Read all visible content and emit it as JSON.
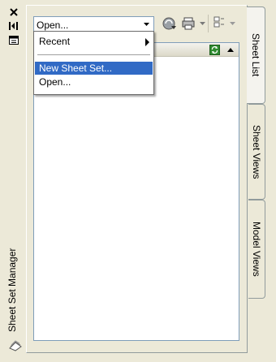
{
  "window": {
    "title": "Sheet Set Manager"
  },
  "combo": {
    "value": "Open..."
  },
  "dropdown": {
    "items": [
      {
        "label": "Recent",
        "submenu": true
      },
      {
        "label": "New Sheet Set...",
        "highlighted": true
      },
      {
        "label": "Open..."
      }
    ]
  },
  "tabs": [
    {
      "label": "Sheet List",
      "active": true
    },
    {
      "label": "Sheet Views"
    },
    {
      "label": "Model Views"
    }
  ],
  "icons": {
    "close": "close-icon",
    "autohide": "autohide-icon",
    "properties": "properties-icon",
    "publish_dwf": "publish-dwf-icon",
    "publish_plotter": "publish-plotter-icon",
    "sheet_selections": "sheet-selections-icon",
    "refresh": "refresh-icon",
    "collapse": "collapse-up-icon",
    "ssm": "sheet-set-manager-icon"
  },
  "colors": {
    "highlight": "#316ac5",
    "background": "#ece9d8",
    "border": "#7f9db9"
  }
}
